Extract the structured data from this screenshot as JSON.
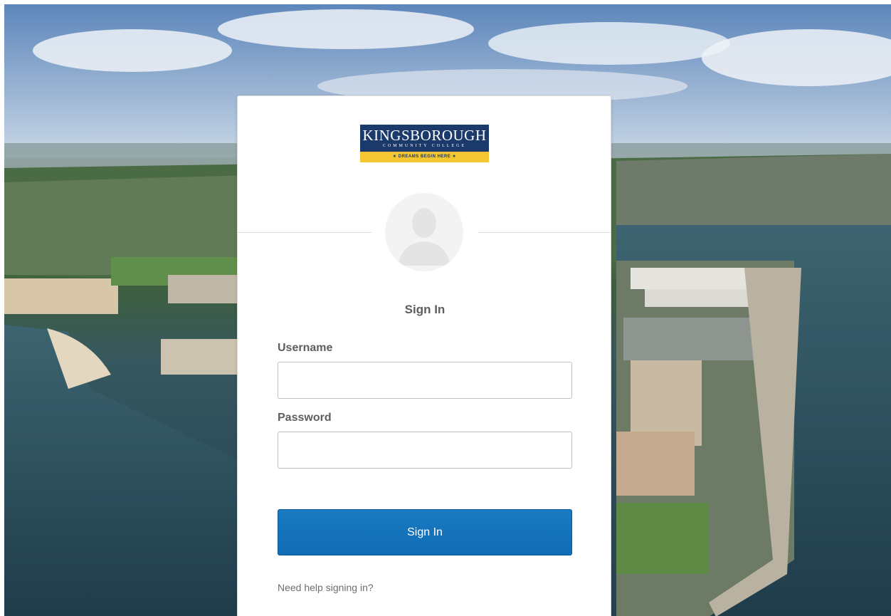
{
  "logo": {
    "main": "KINGSBOROUGH",
    "sub": "COMMUNITY COLLEGE",
    "tagline": "★ DREAMS BEGIN HERE ★"
  },
  "form": {
    "title": "Sign In",
    "username_label": "Username",
    "username_value": "",
    "password_label": "Password",
    "password_value": "",
    "submit_label": "Sign In",
    "help_link": "Need help signing in?"
  },
  "colors": {
    "button": "#1279c2",
    "logo_navy": "#1b3a6b",
    "logo_gold": "#f3c632"
  }
}
